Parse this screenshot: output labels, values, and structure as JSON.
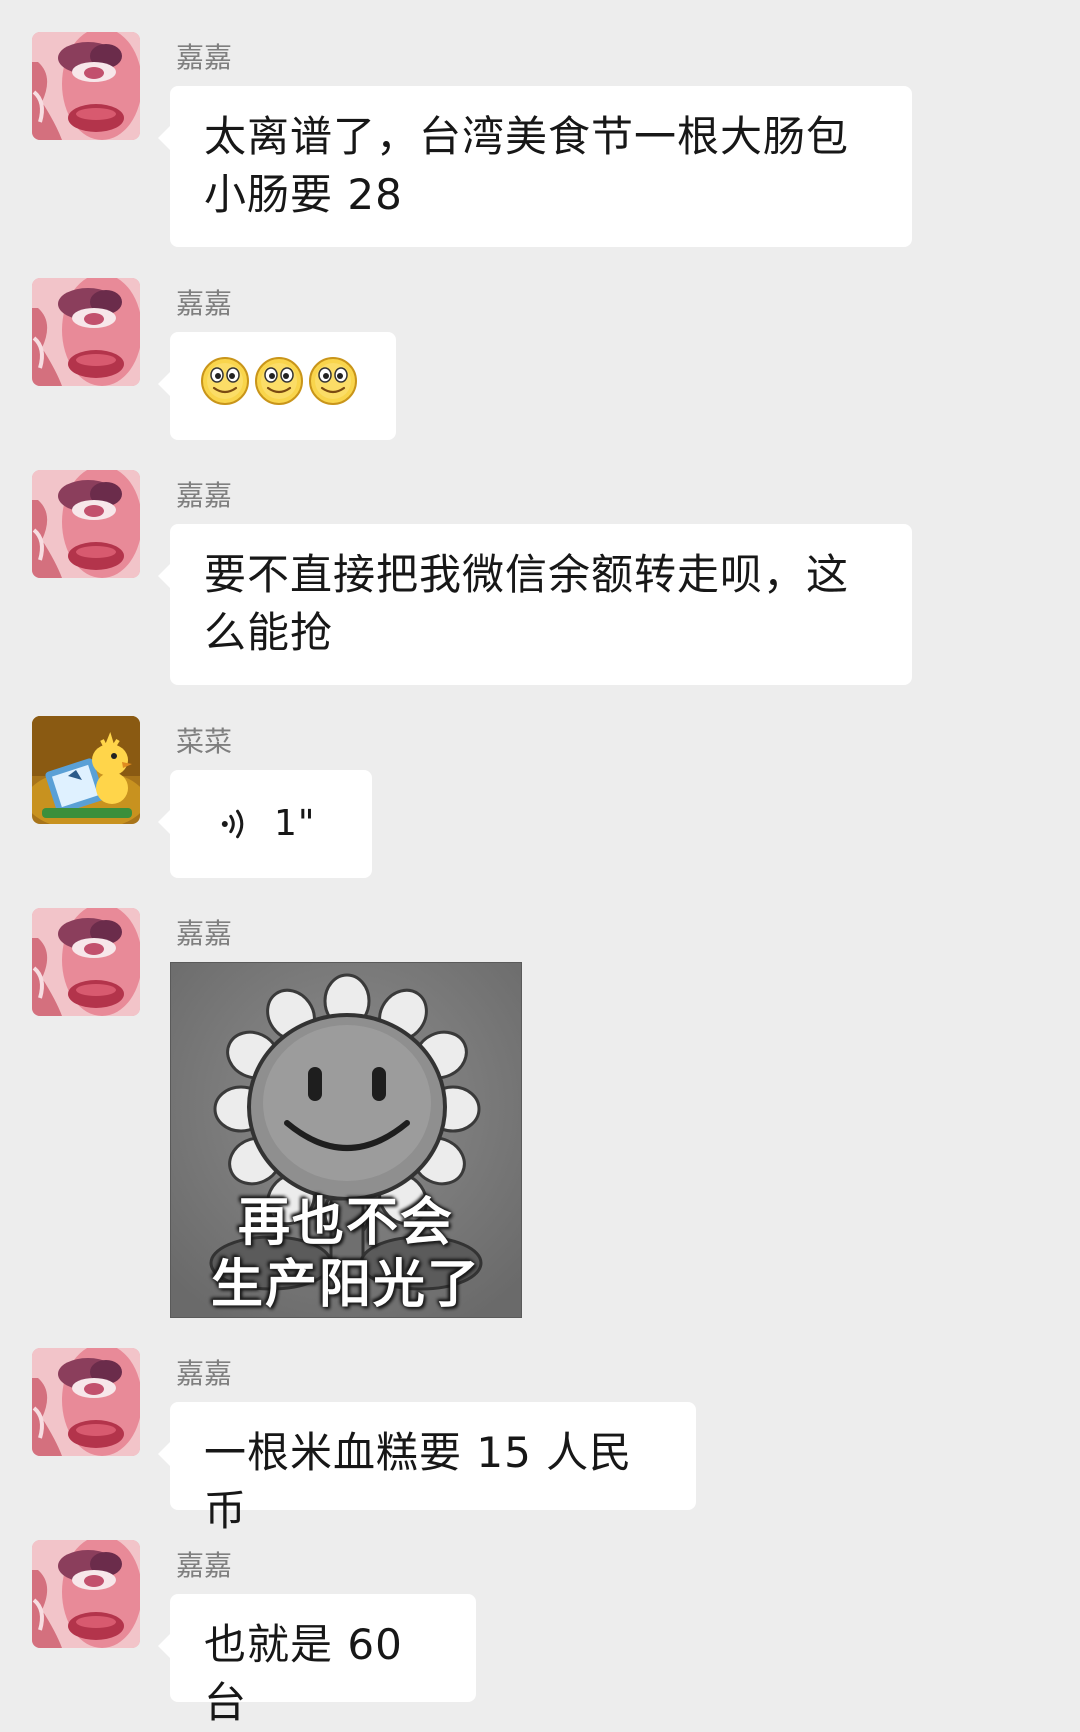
{
  "messages": [
    {
      "sender": "嘉嘉",
      "avatar": "pink-face-avatar-icon",
      "text_lines": [
        "太离谱了，台湾美食节一根大肠包",
        "小肠要 28"
      ]
    },
    {
      "sender": "嘉嘉",
      "avatar": "pink-face-avatar-icon",
      "emojis": [
        "smiley-face-icon",
        "smiley-face-icon",
        "smiley-face-icon"
      ]
    },
    {
      "sender": "嘉嘉",
      "avatar": "pink-face-avatar-icon",
      "text_lines": [
        "要不直接把我微信余额转走呗，这",
        "么能抢"
      ]
    },
    {
      "sender": "菜菜",
      "avatar": "yellow-bird-avatar-icon",
      "voice_duration": "1\""
    },
    {
      "sender": "嘉嘉",
      "avatar": "pink-face-avatar-icon",
      "sticker_caption_lines": [
        "再也不会",
        "生产阳光了"
      ],
      "sticker_icon": "sunflower-sticker-icon"
    },
    {
      "sender": "嘉嘉",
      "avatar": "pink-face-avatar-icon",
      "text": "一根米血糕要 15 人民币"
    },
    {
      "sender": "嘉嘉",
      "avatar": "pink-face-avatar-icon",
      "text": "也就是 60 台"
    }
  ],
  "colors": {
    "background": "#ededed",
    "bubble": "#ffffff",
    "sender_name": "#7f7f7f"
  }
}
